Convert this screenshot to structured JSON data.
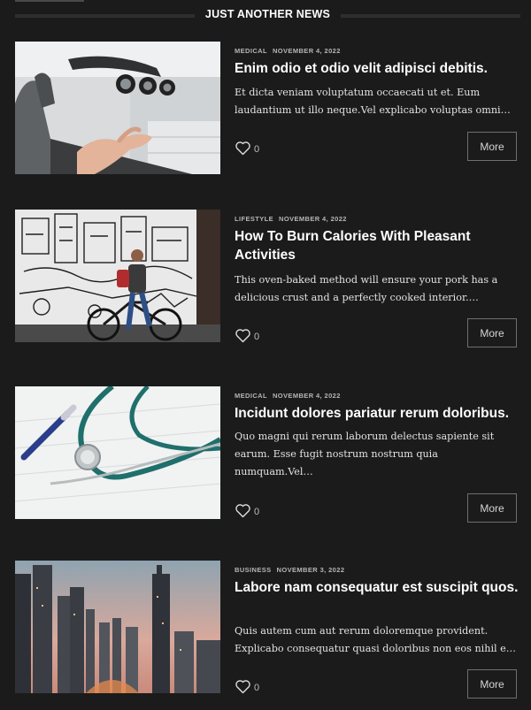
{
  "section": {
    "title": "JUST ANOTHER NEWS"
  },
  "posts": [
    {
      "category": "MEDICAL",
      "date": "NOVEMBER 4, 2022",
      "title": "Enim odio et odio velit adipisci debitis.",
      "excerpt": "Et dicta veniam voluptatum occaecati ut et. Eum laudantium ut illo neque.Vel explicabo voluptas omni…",
      "likes": "0",
      "more_label": "More"
    },
    {
      "category": "LIFESTYLE",
      "date": "NOVEMBER 4, 2022",
      "title": "How To Burn Calories With Pleasant Activities",
      "excerpt": "This oven-baked method will ensure your pork has a delicious crust and a perfectly cooked interior.…",
      "likes": "0",
      "more_label": "More"
    },
    {
      "category": "MEDICAL",
      "date": "NOVEMBER 4, 2022",
      "title": "Incidunt dolores pariatur rerum doloribus.",
      "excerpt": "Quo magni qui rerum laborum delectus sapiente sit earum. Esse fugit nostrum nostrum quia numquam.Vel…",
      "likes": "0",
      "more_label": "More"
    },
    {
      "category": "BUSINESS",
      "date": "NOVEMBER 3, 2022",
      "title": "Labore nam consequatur est suscipit quos.",
      "excerpt": "Quis autem cum aut rerum doloremque provident. Explicabo consequatur quasi doloribus non eos nihil e…",
      "likes": "0",
      "more_label": "More"
    }
  ]
}
